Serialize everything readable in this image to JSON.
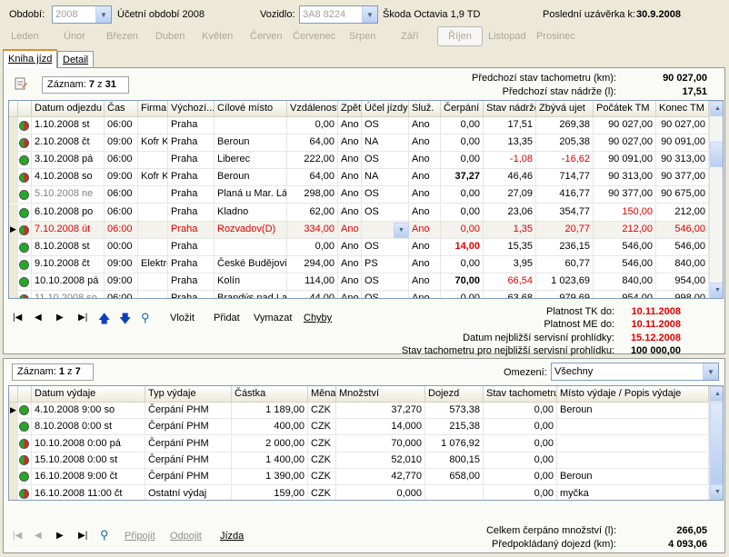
{
  "top": {
    "period_label": "Období:",
    "period_value": "2008",
    "period_text": "Účetní období 2008",
    "vehicle_label": "Vozidlo:",
    "vehicle_value": "3A8 8224",
    "vehicle_name": "Škoda Octavia 1,9 TD",
    "last_close_label": "Poslední uzávěrka k:",
    "last_close_value": "30.9.2008"
  },
  "months": [
    "Leden",
    "Únor",
    "Březen",
    "Duben",
    "Květen",
    "Červen",
    "Červenec",
    "Srpen",
    "Září",
    "Říjen",
    "Listopad",
    "Prosinec"
  ],
  "tabs": [
    "Kniha jízd",
    "Detail"
  ],
  "upper": {
    "record_label": "Záznam:",
    "record_num": "7",
    "record_of": "z",
    "record_total": "31",
    "prev_odo_label": "Předchozí stav tachometru (km):",
    "prev_odo_value": "90 027,00",
    "prev_tank_label": "Předchozí stav nádrže (l):",
    "prev_tank_value": "17,51"
  },
  "trips_headers": [
    "Datum odjezdu",
    "Čas",
    "Firma",
    "Výchozí...",
    "Cílové místo",
    "Vzdálenost",
    "Zpět",
    "Účel jízdy",
    "Služ.",
    "Čerpání",
    "Stav nádrže",
    "Zbývá ujet",
    "Počátek TM",
    "Konec TM"
  ],
  "trips": [
    [
      "1.10.2008 st",
      "06:00",
      "",
      "Praha",
      "",
      "0,00",
      "Ano",
      "OS",
      "Ano",
      "0,00",
      "17,51",
      "269,38",
      "90 027,00",
      "90 027,00"
    ],
    [
      "2.10.2008 čt",
      "09:00",
      "Kofr K.",
      "Praha",
      "Beroun",
      "64,00",
      "Ano",
      "NA",
      "Ano",
      "0,00",
      "13,35",
      "205,38",
      "90 027,00",
      "90 091,00"
    ],
    [
      "3.10.2008 pá",
      "06:00",
      "",
      "Praha",
      "Liberec",
      "222,00",
      "Ano",
      "OS",
      "Ano",
      "0,00",
      "-1,08",
      "-16,62",
      "90 091,00",
      "90 313,00"
    ],
    [
      "4.10.2008 so",
      "09:00",
      "Kofr K.",
      "Praha",
      "Beroun",
      "64,00",
      "Ano",
      "NA",
      "Ano",
      "37,27",
      "46,46",
      "714,77",
      "90 313,00",
      "90 377,00"
    ],
    [
      "5.10.2008 ne",
      "06:00",
      "",
      "Praha",
      "Planá u Mar. Láz",
      "298,00",
      "Ano",
      "OS",
      "Ano",
      "0,00",
      "27,09",
      "416,77",
      "90 377,00",
      "90 675,00"
    ],
    [
      "6.10.2008 po",
      "06:00",
      "",
      "Praha",
      "Kladno",
      "62,00",
      "Ano",
      "OS",
      "Ano",
      "0,00",
      "23,06",
      "354,77",
      "150,00",
      "212,00"
    ],
    [
      "7.10.2008 út",
      "06:00",
      "",
      "Praha",
      "Rozvadov(D)",
      "334,00",
      "Ano",
      "",
      "Ano",
      "0,00",
      "1,35",
      "20,77",
      "212,00",
      "546,00"
    ],
    [
      "8.10.2008 st",
      "00:00",
      "",
      "Praha",
      "",
      "0,00",
      "Ano",
      "OS",
      "Ano",
      "14,00",
      "15,35",
      "236,15",
      "546,00",
      "546,00"
    ],
    [
      "9.10.2008 čt",
      "09:00",
      "Elektro",
      "Praha",
      "České Budějovic",
      "294,00",
      "Ano",
      "PS",
      "Ano",
      "0,00",
      "3,95",
      "60,77",
      "546,00",
      "840,00"
    ],
    [
      "10.10.2008 pá",
      "09:00",
      "",
      "Praha",
      "Kolín",
      "114,00",
      "Ano",
      "OS",
      "Ano",
      "70,00",
      "66,54",
      "1 023,69",
      "840,00",
      "954,00"
    ],
    [
      "11.10.2008 so",
      "06:00",
      "",
      "Praha",
      "Brandýs nad Lab",
      "44,00",
      "Ano",
      "OS",
      "Ano",
      "0,00",
      "63,68",
      "979,69",
      "954,00",
      "998,00"
    ]
  ],
  "upper_nav": {
    "insert": "Vložit",
    "add": "Přidat",
    "delete": "Vymazat",
    "errors": "Chyby"
  },
  "validity": {
    "tk_label": "Platnost TK do:",
    "tk_value": "10.11.2008",
    "me_label": "Platnost ME do:",
    "me_value": "10.11.2008",
    "service_label": "Datum nejbližší servisní prohlídky:",
    "service_value": "15.12.2008",
    "odo_label": "Stav tachometru pro nejbližší servisní prohlídku:",
    "odo_value": "100 000,00"
  },
  "lower": {
    "record_label": "Záznam:",
    "record_num": "1",
    "record_of": "z",
    "record_total": "7",
    "filter_label": "Omezení:",
    "filter_value": "Všechny"
  },
  "exp_headers": [
    "Datum výdaje",
    "Typ výdaje",
    "Částka",
    "Měna",
    "Množství",
    "Dojezd",
    "Stav tachometru",
    "Místo výdaje / Popis výdaje"
  ],
  "expenses": [
    [
      "4.10.2008 9:00 so",
      "Čerpání PHM",
      "1 189,00",
      "CZK",
      "37,270",
      "573,38",
      "0,00",
      "Beroun"
    ],
    [
      "8.10.2008 0:00 st",
      "Čerpání PHM",
      "400,00",
      "CZK",
      "14,000",
      "215,38",
      "0,00",
      ""
    ],
    [
      "10.10.2008 0:00 pá",
      "Čerpání PHM",
      "2 000,00",
      "CZK",
      "70,000",
      "1 076,92",
      "0,00",
      ""
    ],
    [
      "15.10.2008 0:00 st",
      "Čerpání PHM",
      "1 400,00",
      "CZK",
      "52,010",
      "800,15",
      "0,00",
      ""
    ],
    [
      "16.10.2008 9:00 čt",
      "Čerpání PHM",
      "1 390,00",
      "CZK",
      "42,770",
      "658,00",
      "0,00",
      "Beroun"
    ],
    [
      "16.10.2008 11:00 čt",
      "Ostatní výdaj",
      "159,00",
      "CZK",
      "0,000",
      "",
      "0,00",
      "myčka"
    ]
  ],
  "lower_nav": {
    "attach": "Připojit",
    "detach": "Odpojit",
    "trip": "Jízda"
  },
  "totals": {
    "fuel_label": "Celkem čerpáno množství (l):",
    "fuel_value": "266,05",
    "range_label": "Předpokládaný dojezd (km):",
    "range_value": "4 093,06"
  }
}
